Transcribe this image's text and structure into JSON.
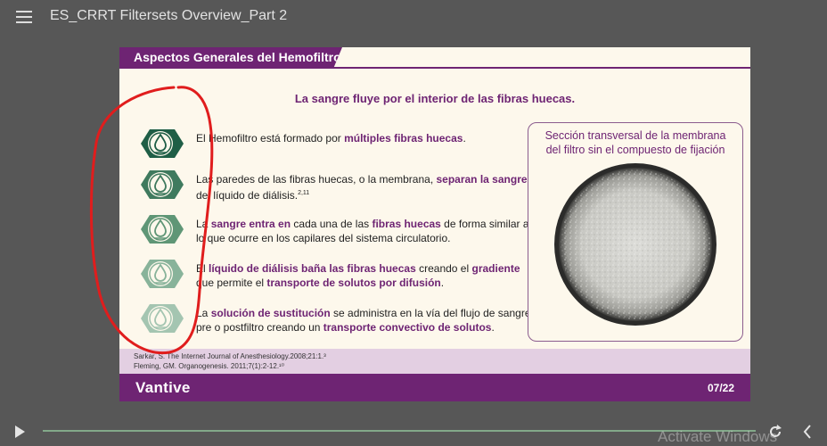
{
  "window": {
    "title": "ES_CRRT Filtersets Overview_Part 2"
  },
  "slide": {
    "header": "Aspectos Generales del Hemofiltro",
    "subtitle": "La sangre fluye por el interior de las fibras huecas.",
    "items": [
      {
        "parts": [
          {
            "t": "El Hemofiltro está formado por ",
            "hl": false
          },
          {
            "t": "múltiples fibras huecas",
            "hl": true
          },
          {
            "t": ".",
            "hl": false
          }
        ]
      },
      {
        "parts": [
          {
            "t": "Las paredes de las fibras huecas, o la membrana, ",
            "hl": false
          },
          {
            "t": "separan la sangre",
            "hl": true
          },
          {
            "t": " del líquido de diálisis.",
            "hl": false
          },
          {
            "t": "2,11",
            "hl": false,
            "sup": true
          }
        ]
      },
      {
        "parts": [
          {
            "t": "La ",
            "hl": false
          },
          {
            "t": "sangre entra en",
            "hl": true
          },
          {
            "t": " cada una de las ",
            "hl": false
          },
          {
            "t": "fibras huecas",
            "hl": true
          },
          {
            "t": " de forma similar a lo que ocurre en los capilares del sistema circulatorio.",
            "hl": false
          }
        ]
      },
      {
        "parts": [
          {
            "t": "El ",
            "hl": false
          },
          {
            "t": "líquido de diálisis baña las fibras huecas",
            "hl": true
          },
          {
            "t": " creando el ",
            "hl": false
          },
          {
            "t": "gradiente",
            "hl": true
          },
          {
            "t": " que permite el ",
            "hl": false
          },
          {
            "t": "transporte de solutos por difusión",
            "hl": true
          },
          {
            "t": ".",
            "hl": false
          }
        ]
      },
      {
        "parts": [
          {
            "t": "La ",
            "hl": false
          },
          {
            "t": "solución de sustitución",
            "hl": true
          },
          {
            "t": " se administra en la vía del flujo de sangre pre o postfiltro creando un ",
            "hl": false
          },
          {
            "t": "transporte convectivo de solutos",
            "hl": true
          },
          {
            "t": ".",
            "hl": false
          }
        ]
      }
    ],
    "membrane_caption": "Sección transversal de la membrana del filtro sin el compuesto de fijación",
    "references": [
      "Sarkar, S. The Internet Journal of Anesthesiology.2008;21:1.³",
      "Fleming, GM. Organogenesis. 2011;7(1):2-12.¹⁰"
    ],
    "brand": "Vantive",
    "page": "07/22"
  },
  "player": {
    "watermark": "Activate Windows"
  },
  "colors": {
    "purple": "#6e2473",
    "icon_shades": [
      "#1f5e46",
      "#3f7a5e",
      "#5f9676",
      "#88b39a",
      "#a4c5b1"
    ]
  },
  "icons": {
    "item": "water-drop-icon"
  }
}
